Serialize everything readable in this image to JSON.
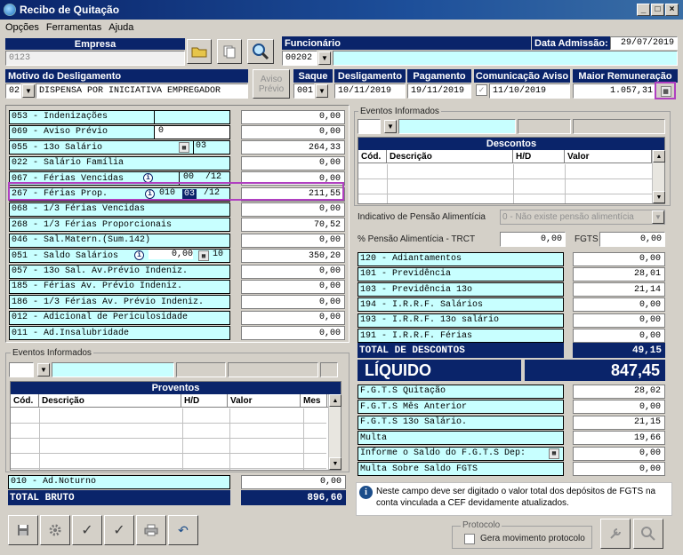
{
  "window": {
    "title": "Recibo de Quitação"
  },
  "menu": [
    "Opções",
    "Ferramentas",
    "Ajuda"
  ],
  "empresa": {
    "label": "Empresa",
    "code": "0123"
  },
  "funcionario": {
    "label": "Funcionário",
    "code": "00202",
    "admissao_label": "Data Admissão:",
    "admissao": "29/07/2019"
  },
  "motivo": {
    "label": "Motivo do Desligamento",
    "code": "02",
    "text": "DISPENSA POR INICIATIVA EMPREGADOR"
  },
  "aviso_previo": {
    "line1": "Aviso",
    "line2": "Prévio"
  },
  "saque": {
    "label": "Saque",
    "code": "001"
  },
  "desligamento": {
    "label": "Desligamento",
    "value": "10/11/2019"
  },
  "pagamento": {
    "label": "Pagamento",
    "value": "19/11/2019"
  },
  "comunicacao": {
    "label": "Comunicação Aviso",
    "value": "11/10/2019"
  },
  "maior_remuneracao": {
    "label": "Maior Remuneração",
    "value": "1.057,31"
  },
  "verbas": [
    {
      "label": "053 - Indenizações",
      "value": "0,00"
    },
    {
      "label": "069 - Aviso Prévio",
      "extra": "0",
      "value": "0,00"
    },
    {
      "label": "055 - 13o Salário",
      "extra": "03",
      "value": "264,33"
    },
    {
      "label": "022 - Salário Família",
      "value": "0,00"
    },
    {
      "label": "067 - Férias Vencidas",
      "extra": "00",
      "extra2": "/12",
      "value": "0,00"
    },
    {
      "label": "267 - Férias Prop.",
      "extra": "010",
      "extra2": "03",
      "extra3": "/12",
      "value": "211,55"
    },
    {
      "label": "068 - 1/3 Férias Vencidas",
      "value": "0,00"
    },
    {
      "label": "268 - 1/3 Férias Proporcionais",
      "value": "70,52"
    },
    {
      "label": "046 - Sal.Matern.(Sum.142)",
      "value": "0,00"
    },
    {
      "label": "051 - Saldo Salários",
      "extra": "0,00",
      "extra2": "10",
      "value": "350,20"
    },
    {
      "label": "057 - 13o Sal. Av.Prévio Indeniz.",
      "value": "0,00"
    },
    {
      "label": "185 - Férias  Av. Prévio Indeniz.",
      "value": "0,00"
    },
    {
      "label": "186 - 1/3 Férias Av. Prévio Indeniz.",
      "value": "0,00"
    },
    {
      "label": "012 - Adicional de Periculosidade",
      "value": "0,00"
    },
    {
      "label": "011 - Ad.Insalubridade",
      "value": "0,00"
    }
  ],
  "eventos_informados": "Eventos Informados",
  "proventos": {
    "title": "Proventos",
    "cols": [
      "Cód.",
      "Descrição",
      "H/D",
      "Valor",
      "Mes"
    ]
  },
  "ad_noturno": {
    "label": "010 - Ad.Noturno",
    "value": "0,00"
  },
  "total_bruto": {
    "label": "TOTAL BRUTO",
    "value": "896,60"
  },
  "descontos": {
    "title": "Descontos",
    "cols": [
      "Cód.",
      "Descrição",
      "H/D",
      "Valor"
    ]
  },
  "pensao": {
    "label": "Indicativo de Pensão Alimentícia",
    "value": "0 - Não existe pensão alimentícia"
  },
  "pct_pensao": {
    "label": "% Pensão Alimentícia - TRCT",
    "value": "0,00",
    "fgts_label": "FGTS",
    "fgts_value": "0,00"
  },
  "desc_rows": [
    {
      "label": "120 - Adiantamentos",
      "value": "0,00"
    },
    {
      "label": "101 - Previdência",
      "value": "28,01"
    },
    {
      "label": "103 - Previdência 13o",
      "value": "21,14"
    },
    {
      "label": "194 - I.R.R.F. Salários",
      "value": "0,00"
    },
    {
      "label": "193 - I.R.R.F. 13o salário",
      "value": "0,00"
    },
    {
      "label": "191 - I.R.R.F. Férias",
      "value": "0,00"
    }
  ],
  "total_descontos": {
    "label": "TOTAL DE DESCONTOS",
    "value": "49,15"
  },
  "liquido": {
    "label": "LÍQUIDO",
    "value": "847,45"
  },
  "fgts_rows": [
    {
      "label": "F.G.T.S  Quitação",
      "value": "28,02"
    },
    {
      "label": "F.G.T.S  Mês Anterior",
      "value": "0,00"
    },
    {
      "label": "F.G.T.S  13o Salário.",
      "value": "21,15"
    },
    {
      "label": "Multa",
      "value": "19,66"
    },
    {
      "label": "Informe o Saldo do F.G.T.S Dep:",
      "value": "0,00"
    },
    {
      "label": "Multa Sobre Saldo FGTS",
      "value": "0,00"
    }
  ],
  "hint": "Neste campo deve ser digitado o valor total dos depósitos de FGTS na conta vinculada a CEF devidamente atualizados.",
  "protocolo": {
    "legend": "Protocolo",
    "checkbox": "Gera movimento protocolo"
  }
}
